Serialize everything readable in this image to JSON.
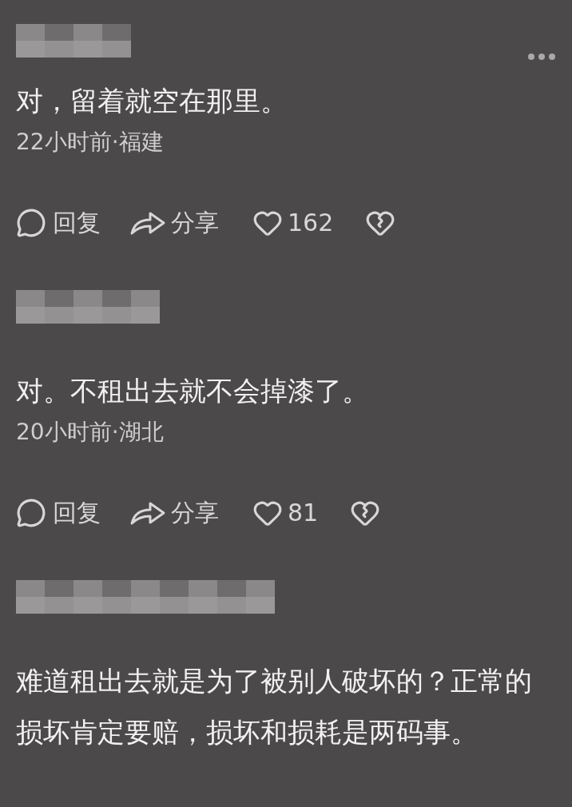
{
  "comments": [
    {
      "text": "对，留着就空在那里。",
      "meta": "22小时前·福建",
      "more_menu": true,
      "actions": {
        "reply": "回复",
        "share": "分享",
        "likes": "162"
      }
    },
    {
      "text": "对。不租出去就不会掉漆了。",
      "meta": "20小时前·湖北",
      "more_menu": false,
      "actions": {
        "reply": "回复",
        "share": "分享",
        "likes": "81"
      }
    },
    {
      "text": "难道租出去就是为了被别人破坏的？正常的损坏肯定要赔，损坏和损耗是两码事。",
      "more_menu": false
    }
  ]
}
